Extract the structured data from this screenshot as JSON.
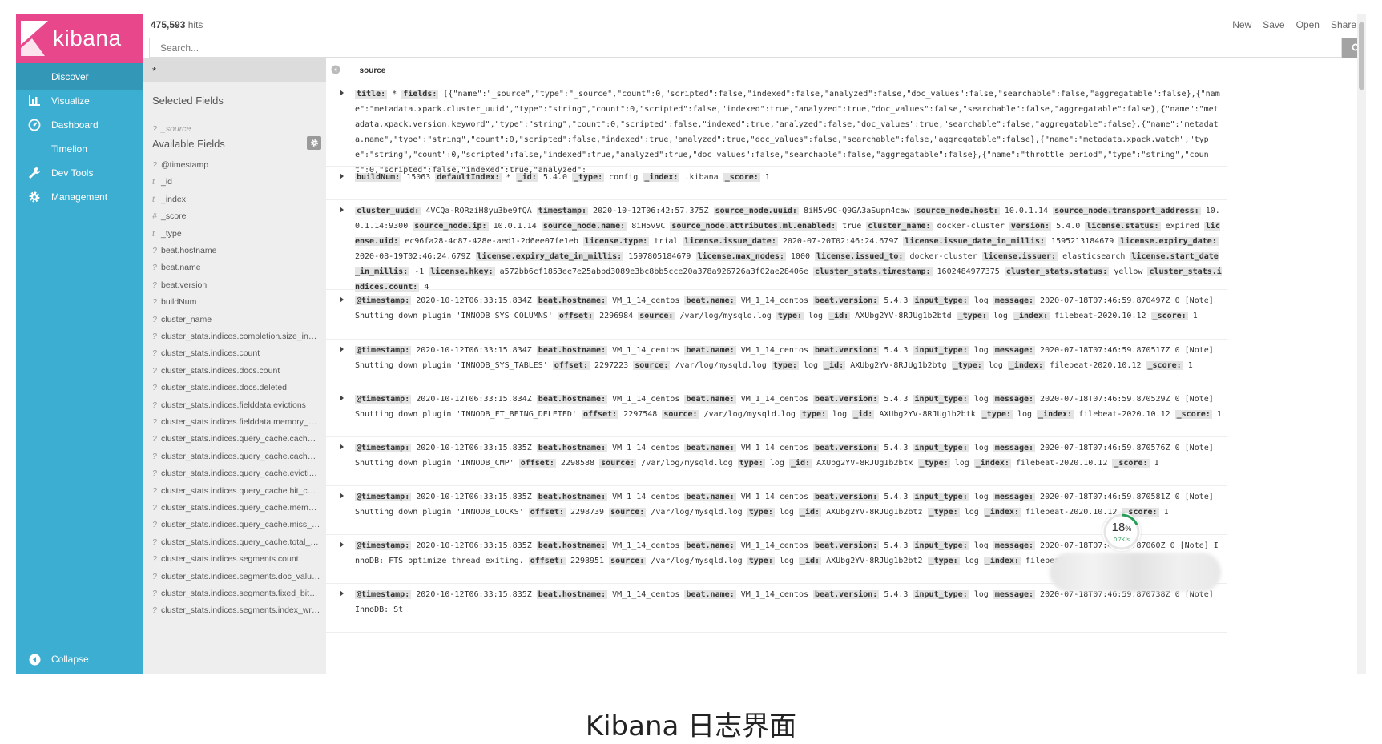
{
  "app": {
    "logo_text": "kibana",
    "hits_count": "475,593",
    "hits_label": "hits",
    "top_menu": [
      "New",
      "Save",
      "Open",
      "Share"
    ],
    "search_placeholder": "Search..."
  },
  "nav": {
    "items": [
      {
        "label": "Discover",
        "icon": "compass-icon",
        "active": true
      },
      {
        "label": "Visualize",
        "icon": "bar-chart-icon",
        "active": false
      },
      {
        "label": "Dashboard",
        "icon": "dashboard-icon",
        "active": false
      },
      {
        "label": "Timelion",
        "icon": "timelion-icon",
        "active": false
      },
      {
        "label": "Dev Tools",
        "icon": "wrench-icon",
        "active": false
      },
      {
        "label": "Management",
        "icon": "gear-icon",
        "active": false
      }
    ],
    "collapse_label": "Collapse"
  },
  "sidebar": {
    "index_pattern": "*",
    "selected_header": "Selected Fields",
    "selected_fields": [
      {
        "type": "?",
        "name": "_source"
      }
    ],
    "available_header": "Available Fields",
    "available_fields": [
      {
        "type": "?",
        "name": "@timestamp"
      },
      {
        "type": "t",
        "name": "_id"
      },
      {
        "type": "t",
        "name": "_index"
      },
      {
        "type": "#",
        "name": "_score"
      },
      {
        "type": "t",
        "name": "_type"
      },
      {
        "type": "?",
        "name": "beat.hostname"
      },
      {
        "type": "?",
        "name": "beat.name"
      },
      {
        "type": "?",
        "name": "beat.version"
      },
      {
        "type": "?",
        "name": "buildNum"
      },
      {
        "type": "?",
        "name": "cluster_name"
      },
      {
        "type": "?",
        "name": "cluster_stats.indices.completion.size_in_by..."
      },
      {
        "type": "?",
        "name": "cluster_stats.indices.count"
      },
      {
        "type": "?",
        "name": "cluster_stats.indices.docs.count"
      },
      {
        "type": "?",
        "name": "cluster_stats.indices.docs.deleted"
      },
      {
        "type": "?",
        "name": "cluster_stats.indices.fielddata.evictions"
      },
      {
        "type": "?",
        "name": "cluster_stats.indices.fielddata.memory_siz..."
      },
      {
        "type": "?",
        "name": "cluster_stats.indices.query_cache.cache_co..."
      },
      {
        "type": "?",
        "name": "cluster_stats.indices.query_cache.cache_size"
      },
      {
        "type": "?",
        "name": "cluster_stats.indices.query_cache.evictions"
      },
      {
        "type": "?",
        "name": "cluster_stats.indices.query_cache.hit_count"
      },
      {
        "type": "?",
        "name": "cluster_stats.indices.query_cache.memory..."
      },
      {
        "type": "?",
        "name": "cluster_stats.indices.query_cache.miss_cou..."
      },
      {
        "type": "?",
        "name": "cluster_stats.indices.query_cache.total_cou..."
      },
      {
        "type": "?",
        "name": "cluster_stats.indices.segments.count"
      },
      {
        "type": "?",
        "name": "cluster_stats.indices.segments.doc_values_..."
      },
      {
        "type": "?",
        "name": "cluster_stats.indices.segments.fixed_bit_se..."
      },
      {
        "type": "?",
        "name": "cluster_stats.indices.segments.index_write..."
      }
    ]
  },
  "documents": {
    "column_header": "_source",
    "rows": [
      {
        "segments": [
          [
            "title:",
            "*"
          ],
          [
            "fields:",
            "[{\"name\":\"_source\",\"type\":\"_source\",\"count\":0,\"scripted\":false,\"indexed\":false,\"analyzed\":false,\"doc_values\":false,\"searchable\":false,\"aggregatable\":false},{\"name\":\"metadata.xpack.cluster_uuid\",\"type\":\"string\",\"count\":0,\"scripted\":false,\"indexed\":true,\"analyzed\":true,\"doc_values\":false,\"searchable\":false,\"aggregatable\":false},{\"name\":\"metadata.xpack.version.keyword\",\"type\":\"string\",\"count\":0,\"scripted\":false,\"indexed\":true,\"analyzed\":false,\"doc_values\":true,\"searchable\":false,\"aggregatable\":false},{\"name\":\"metadata.name\",\"type\":\"string\",\"count\":0,\"scripted\":false,\"indexed\":true,\"analyzed\":true,\"doc_values\":false,\"searchable\":false,\"aggregatable\":false},{\"name\":\"metadata.xpack.watch\",\"type\":\"string\",\"count\":0,\"scripted\":false,\"indexed\":true,\"analyzed\":true,\"doc_values\":false,\"searchable\":false,\"aggregatable\":false},{\"name\":\"throttle_period\",\"type\":\"string\",\"count\":0,\"scripted\":false,\"indexed\":true,\"analyzed\":"
          ]
        ]
      },
      {
        "segments": [
          [
            "buildNum:",
            "15063"
          ],
          [
            "defaultIndex:",
            "*"
          ],
          [
            "_id:",
            "5.4.0"
          ],
          [
            "_type:",
            "config"
          ],
          [
            "_index:",
            ".kibana"
          ],
          [
            "_score:",
            "1"
          ]
        ]
      },
      {
        "segments": [
          [
            "cluster_uuid:",
            "4VCQa-RORziH8yu3be9fQA"
          ],
          [
            "timestamp:",
            "2020-10-12T06:42:57.375Z"
          ],
          [
            "source_node.uuid:",
            "8iH5v9C-Q9GA3aSupm4caw"
          ],
          [
            "source_node.host:",
            "10.0.1.14"
          ],
          [
            "source_node.transport_address:",
            "10.0.1.14:9300"
          ],
          [
            "source_node.ip:",
            "10.0.1.14"
          ],
          [
            "source_node.name:",
            "8iH5v9C"
          ],
          [
            "source_node.attributes.ml.enabled:",
            "true"
          ],
          [
            "cluster_name:",
            "docker-cluster"
          ],
          [
            "version:",
            "5.4.0"
          ],
          [
            "license.status:",
            "expired"
          ],
          [
            "license.uid:",
            "ec96fa28-4c87-428e-aed1-2d6ee07fe1eb"
          ],
          [
            "license.type:",
            "trial"
          ],
          [
            "license.issue_date:",
            "2020-07-20T02:46:24.679Z"
          ],
          [
            "license.issue_date_in_millis:",
            "1595213184679"
          ],
          [
            "license.expiry_date:",
            "2020-08-19T02:46:24.679Z"
          ],
          [
            "license.expiry_date_in_millis:",
            "1597805184679"
          ],
          [
            "license.max_nodes:",
            "1000"
          ],
          [
            "license.issued_to:",
            "docker-cluster"
          ],
          [
            "license.issuer:",
            "elasticsearch"
          ],
          [
            "license.start_date_in_millis:",
            "-1"
          ],
          [
            "license.hkey:",
            "a572bb6cf1853ee7e25abbd3089e3bc8bb5cce20a378a926726a3f02ae28406e"
          ],
          [
            "cluster_stats.timestamp:",
            "1602484977375"
          ],
          [
            "cluster_stats.status:",
            "yellow"
          ],
          [
            "cluster_stats.indices.count:",
            "4"
          ]
        ]
      },
      {
        "segments": [
          [
            "@timestamp:",
            "2020-10-12T06:33:15.834Z"
          ],
          [
            "beat.hostname:",
            "VM_1_14_centos"
          ],
          [
            "beat.name:",
            "VM_1_14_centos"
          ],
          [
            "beat.version:",
            "5.4.3"
          ],
          [
            "input_type:",
            "log"
          ],
          [
            "message:",
            "2020-07-18T07:46:59.870497Z 0 [Note] Shutting down plugin 'INNODB_SYS_COLUMNS'"
          ],
          [
            "offset:",
            "2296984"
          ],
          [
            "source:",
            "/var/log/mysqld.log"
          ],
          [
            "type:",
            "log"
          ],
          [
            "_id:",
            "AXUbg2YV-8RJUg1b2btd"
          ],
          [
            "_type:",
            "log"
          ],
          [
            "_index:",
            "filebeat-2020.10.12"
          ],
          [
            "_score:",
            "1"
          ]
        ]
      },
      {
        "segments": [
          [
            "@timestamp:",
            "2020-10-12T06:33:15.834Z"
          ],
          [
            "beat.hostname:",
            "VM_1_14_centos"
          ],
          [
            "beat.name:",
            "VM_1_14_centos"
          ],
          [
            "beat.version:",
            "5.4.3"
          ],
          [
            "input_type:",
            "log"
          ],
          [
            "message:",
            "2020-07-18T07:46:59.870517Z 0 [Note] Shutting down plugin 'INNODB_SYS_TABLES'"
          ],
          [
            "offset:",
            "2297223"
          ],
          [
            "source:",
            "/var/log/mysqld.log"
          ],
          [
            "type:",
            "log"
          ],
          [
            "_id:",
            "AXUbg2YV-8RJUg1b2btg"
          ],
          [
            "_type:",
            "log"
          ],
          [
            "_index:",
            "filebeat-2020.10.12"
          ],
          [
            "_score:",
            "1"
          ]
        ]
      },
      {
        "segments": [
          [
            "@timestamp:",
            "2020-10-12T06:33:15.834Z"
          ],
          [
            "beat.hostname:",
            "VM_1_14_centos"
          ],
          [
            "beat.name:",
            "VM_1_14_centos"
          ],
          [
            "beat.version:",
            "5.4.3"
          ],
          [
            "input_type:",
            "log"
          ],
          [
            "message:",
            "2020-07-18T07:46:59.870529Z 0 [Note] Shutting down plugin 'INNODB_FT_BEING_DELETED'"
          ],
          [
            "offset:",
            "2297548"
          ],
          [
            "source:",
            "/var/log/mysqld.log"
          ],
          [
            "type:",
            "log"
          ],
          [
            "_id:",
            "AXUbg2YV-8RJUg1b2btk"
          ],
          [
            "_type:",
            "log"
          ],
          [
            "_index:",
            "filebeat-2020.10.12"
          ],
          [
            "_score:",
            "1"
          ]
        ]
      },
      {
        "segments": [
          [
            "@timestamp:",
            "2020-10-12T06:33:15.835Z"
          ],
          [
            "beat.hostname:",
            "VM_1_14_centos"
          ],
          [
            "beat.name:",
            "VM_1_14_centos"
          ],
          [
            "beat.version:",
            "5.4.3"
          ],
          [
            "input_type:",
            "log"
          ],
          [
            "message:",
            "2020-07-18T07:46:59.870576Z 0 [Note] Shutting down plugin 'INNODB_CMP'"
          ],
          [
            "offset:",
            "2298588"
          ],
          [
            "source:",
            "/var/log/mysqld.log"
          ],
          [
            "type:",
            "log"
          ],
          [
            "_id:",
            "AXUbg2YV-8RJUg1b2btx"
          ],
          [
            "_type:",
            "log"
          ],
          [
            "_index:",
            "filebeat-2020.10.12"
          ],
          [
            "_score:",
            "1"
          ]
        ]
      },
      {
        "segments": [
          [
            "@timestamp:",
            "2020-10-12T06:33:15.835Z"
          ],
          [
            "beat.hostname:",
            "VM_1_14_centos"
          ],
          [
            "beat.name:",
            "VM_1_14_centos"
          ],
          [
            "beat.version:",
            "5.4.3"
          ],
          [
            "input_type:",
            "log"
          ],
          [
            "message:",
            "2020-07-18T07:46:59.870581Z 0 [Note] Shutting down plugin 'INNODB_LOCKS'"
          ],
          [
            "offset:",
            "2298739"
          ],
          [
            "source:",
            "/var/log/mysqld.log"
          ],
          [
            "type:",
            "log"
          ],
          [
            "_id:",
            "AXUbg2YV-8RJUg1b2btz"
          ],
          [
            "_type:",
            "log"
          ],
          [
            "_index:",
            "filebeat-2020.10.12"
          ],
          [
            "_score:",
            "1"
          ]
        ]
      },
      {
        "segments": [
          [
            "@timestamp:",
            "2020-10-12T06:33:15.835Z"
          ],
          [
            "beat.hostname:",
            "VM_1_14_centos"
          ],
          [
            "beat.name:",
            "VM_1_14_centos"
          ],
          [
            "beat.version:",
            "5.4.3"
          ],
          [
            "input_type:",
            "log"
          ],
          [
            "message:",
            "2020-07-18T07:46:59.87060Z 0 [Note] InnoDB: FTS optimize thread exiting."
          ],
          [
            "offset:",
            "2298951"
          ],
          [
            "source:",
            "/var/log/mysqld.log"
          ],
          [
            "type:",
            "log"
          ],
          [
            "_id:",
            "AXUbg2YV-8RJUg1b2bt2"
          ],
          [
            "_type:",
            "log"
          ],
          [
            "_index:",
            "filebeat-2020.10.12"
          ],
          [
            "_scor",
            ""
          ]
        ]
      },
      {
        "segments": [
          [
            "@timestamp:",
            "2020-10-12T06:33:15.835Z"
          ],
          [
            "beat.hostname:",
            "VM_1_14_centos"
          ],
          [
            "beat.name:",
            "VM_1_14_centos"
          ],
          [
            "beat.version:",
            "5.4.3"
          ],
          [
            "input_type:",
            "log"
          ],
          [
            "message:",
            "2020-07-18T07:46:59.870738Z 0 [Note] InnoDB: St"
          ]
        ]
      }
    ]
  },
  "overlay": {
    "percent": "18",
    "percent_unit": "%",
    "percent_value": 18,
    "rate": "0.7K/s"
  },
  "caption": "Kibana 日志界面",
  "colors": {
    "nav_bg": "#3caed2",
    "nav_active": "#3397b8",
    "logo_bg": "#e8488b",
    "sidebar_bg": "#eeeeee",
    "gauge_green": "#2a9d58"
  }
}
